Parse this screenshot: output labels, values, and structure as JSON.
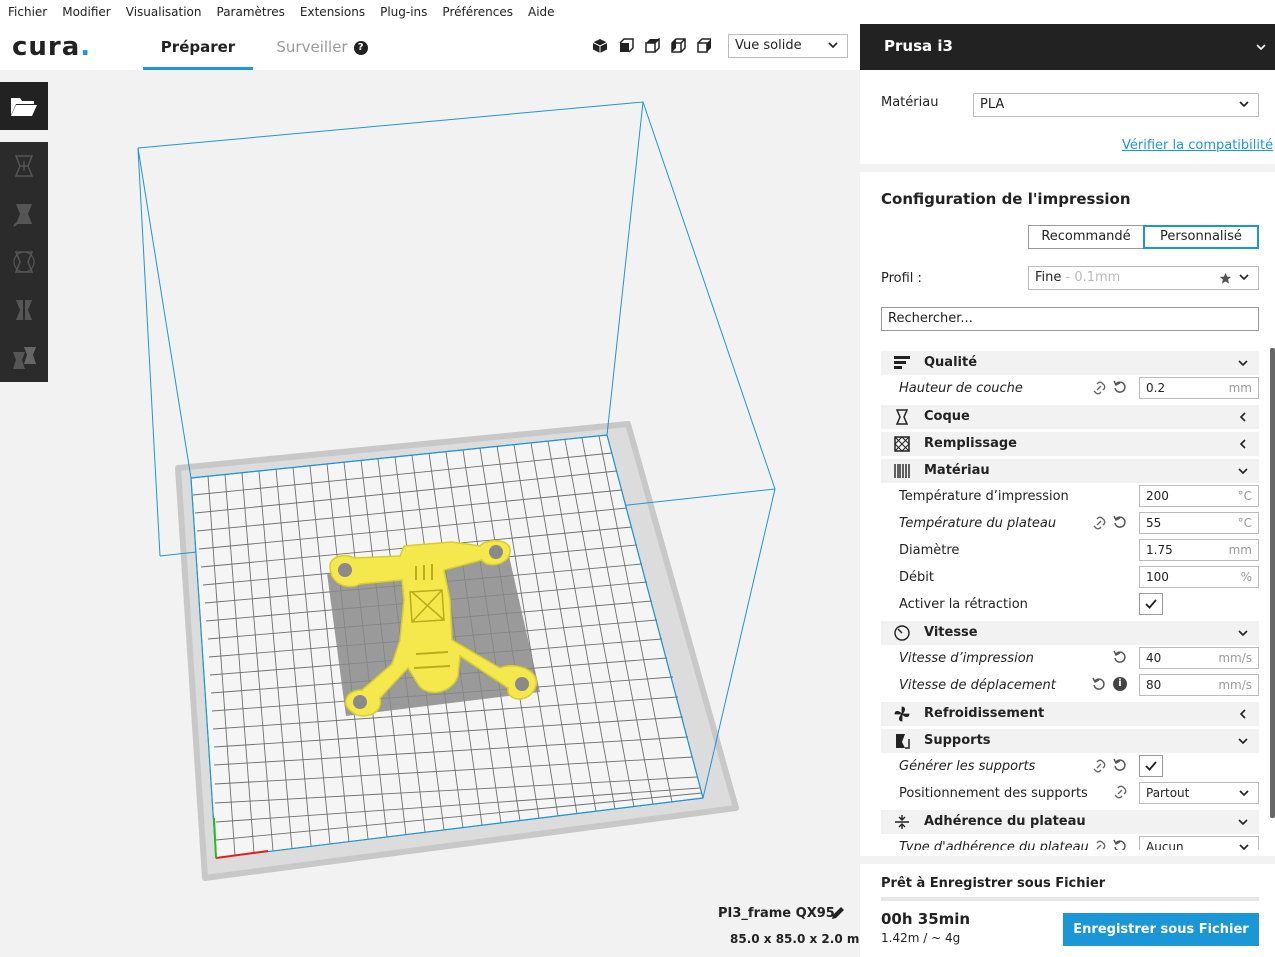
{
  "menu": [
    "Fichier",
    "Modifier",
    "Visualisation",
    "Paramètres",
    "Extensions",
    "Plug-ins",
    "Préférences",
    "Aide"
  ],
  "header": {
    "logo": "cura",
    "tabs": [
      {
        "label": "Préparer",
        "active": true
      },
      {
        "label": "Surveiller",
        "active": false
      }
    ],
    "view_mode": "Vue solide"
  },
  "viewport": {
    "file_name": "PI3_frame QX95",
    "dimensions": "85.0 x 85.0 x 2.0 mm",
    "model_color": "#f4e84d"
  },
  "sidebar": {
    "printer": "Prusa i3",
    "material_label": "Matériau",
    "material_value": "PLA",
    "compat_link": "Vérifier la compatibilité",
    "config_title": "Configuration de l'impression",
    "mode_recommended": "Recommandé",
    "mode_custom": "Personnalisé",
    "profile_label": "Profil :",
    "profile_value": "Fine",
    "profile_sub": " - 0.1mm",
    "search_placeholder": "Rechercher...",
    "categories": {
      "quality": "Qualité",
      "shell": "Coque",
      "infill": "Remplissage",
      "material": "Matériau",
      "speed": "Vitesse",
      "cooling": "Refroidissement",
      "supports": "Supports",
      "adhesion": "Adhérence du plateau"
    },
    "settings": {
      "layer_height": {
        "label": "Hauteur de couche",
        "value": "0.2",
        "unit": "mm"
      },
      "print_temp": {
        "label": "Température d’impression",
        "value": "200",
        "unit": "°C"
      },
      "bed_temp": {
        "label": "Température du plateau",
        "value": "55",
        "unit": "°C"
      },
      "diameter": {
        "label": "Diamètre",
        "value": "1.75",
        "unit": "mm"
      },
      "flow": {
        "label": "Débit",
        "value": "100",
        "unit": "%"
      },
      "retraction": {
        "label": "Activer la rétraction",
        "checked": true
      },
      "print_speed": {
        "label": "Vitesse d’impression",
        "value": "40",
        "unit": "mm/s"
      },
      "travel_speed": {
        "label": "Vitesse de déplacement",
        "value": "80",
        "unit": "mm/s"
      },
      "gen_supports": {
        "label": "Générer les supports",
        "checked": true
      },
      "support_pos": {
        "label": "Positionnement des supports",
        "value": "Partout"
      },
      "adhesion_type": {
        "label": "Type d'adhérence du plateau",
        "value": "Aucun"
      }
    },
    "ready_text": "Prêt à Enregistrer sous Fichier",
    "time": "00h 35min",
    "usage": "1.42m / ~ 4g",
    "save_button": "Enregistrer sous Fichier",
    "accent": "#1b96d6"
  }
}
